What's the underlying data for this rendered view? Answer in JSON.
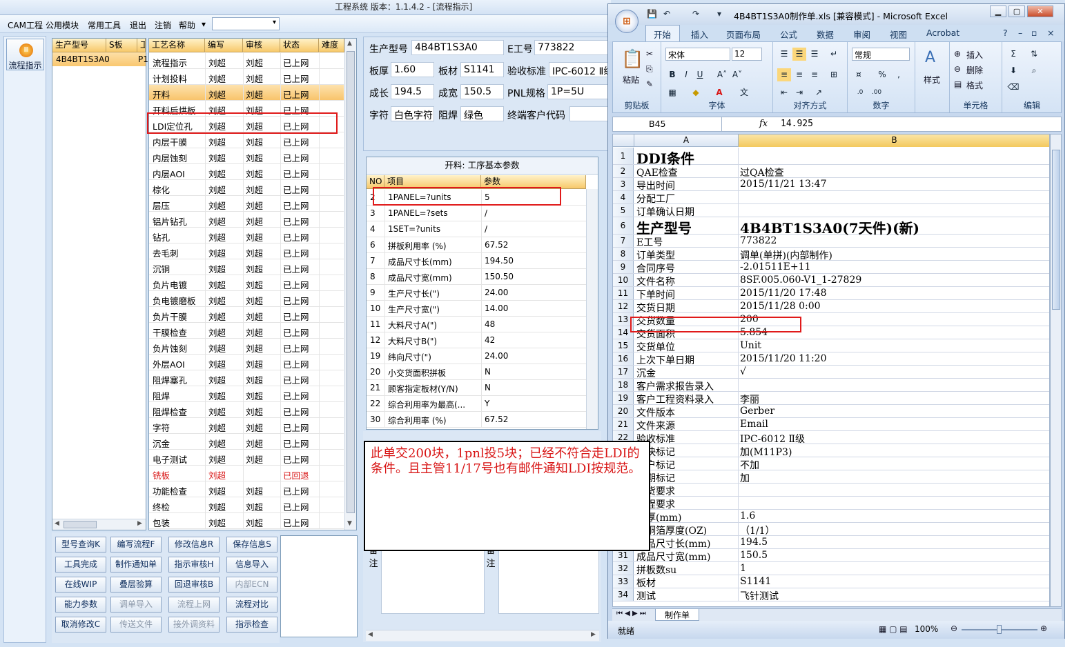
{
  "app": {
    "title": "工程系统   版本：1.1.4.2 - [流程指示]",
    "menu": [
      "CAM工程",
      "公用模块",
      "常用工具",
      "退出",
      "注销",
      "帮助"
    ],
    "menu_combo_arrow": "▾",
    "nav_button_label": "流程指示"
  },
  "model_list": {
    "headers": [
      "生产型号",
      "S板",
      "工"
    ],
    "row": [
      "4B4BT1S3A0",
      "P1"
    ]
  },
  "process_grid": {
    "headers": [
      "工艺名称",
      "编写",
      "审核",
      "状态",
      "难度"
    ],
    "rows": [
      [
        "流程指示",
        "刘超",
        "刘超",
        "已上网"
      ],
      [
        "计划投料",
        "刘超",
        "刘超",
        "已上网"
      ],
      [
        "开料",
        "刘超",
        "刘超",
        "已上网"
      ],
      [
        "开料后烘板",
        "刘超",
        "刘超",
        "已上网"
      ],
      [
        "LDI定位孔",
        "刘超",
        "刘超",
        "已上网"
      ],
      [
        "内层干膜",
        "刘超",
        "刘超",
        "已上网"
      ],
      [
        "内层蚀刻",
        "刘超",
        "刘超",
        "已上网"
      ],
      [
        "内层AOI",
        "刘超",
        "刘超",
        "已上网"
      ],
      [
        "棕化",
        "刘超",
        "刘超",
        "已上网"
      ],
      [
        "层压",
        "刘超",
        "刘超",
        "已上网"
      ],
      [
        "铝片钻孔",
        "刘超",
        "刘超",
        "已上网"
      ],
      [
        "钻孔",
        "刘超",
        "刘超",
        "已上网"
      ],
      [
        "去毛刺",
        "刘超",
        "刘超",
        "已上网"
      ],
      [
        "沉铜",
        "刘超",
        "刘超",
        "已上网"
      ],
      [
        "负片电镀",
        "刘超",
        "刘超",
        "已上网"
      ],
      [
        "负电镀磨板",
        "刘超",
        "刘超",
        "已上网"
      ],
      [
        "负片干膜",
        "刘超",
        "刘超",
        "已上网"
      ],
      [
        "干膜检查",
        "刘超",
        "刘超",
        "已上网"
      ],
      [
        "负片蚀刻",
        "刘超",
        "刘超",
        "已上网"
      ],
      [
        "外层AOI",
        "刘超",
        "刘超",
        "已上网"
      ],
      [
        "阻焊塞孔",
        "刘超",
        "刘超",
        "已上网"
      ],
      [
        "阻焊",
        "刘超",
        "刘超",
        "已上网"
      ],
      [
        "阻焊检查",
        "刘超",
        "刘超",
        "已上网"
      ],
      [
        "字符",
        "刘超",
        "刘超",
        "已上网"
      ],
      [
        "沉金",
        "刘超",
        "刘超",
        "已上网"
      ],
      [
        "电子测试",
        "刘超",
        "刘超",
        "已上网"
      ],
      [
        "铣板",
        "刘超",
        "",
        "已回退"
      ],
      [
        "功能检查",
        "刘超",
        "刘超",
        "已上网"
      ],
      [
        "终检",
        "刘超",
        "刘超",
        "已上网"
      ],
      [
        "包装",
        "刘超",
        "刘超",
        "已上网"
      ]
    ],
    "selected_row": 2,
    "returned_row": 26,
    "highlighted_row": 4
  },
  "info": {
    "model_label": "生产型号",
    "model_value": "4B4BT1S3A0",
    "eno_label": "E工号",
    "eno_value": "773822",
    "thick_label": "板厚",
    "thick_value": "1.60",
    "material_label": "板材",
    "material_value": "S1141",
    "standard_label": "验收标准",
    "standard_value": "IPC-6012 Ⅱ级",
    "len_label": "成长",
    "len_value": "194.5",
    "wid_label": "成宽",
    "wid_value": "150.5",
    "pnl_label": "PNL规格",
    "pnl_value": "1P=5U",
    "char_label": "字符",
    "char_value": "白色字符",
    "mask_label": "阻焊",
    "mask_value": "绿色",
    "customer_label": "终端客户代码",
    "customer_value": ""
  },
  "params": {
    "title": "开料: 工序基本参数",
    "headers": [
      "NO",
      "项目",
      "参数"
    ],
    "rows": [
      [
        "2",
        "1PANEL=?units",
        "5"
      ],
      [
        "3",
        "1PANEL=?sets",
        "/"
      ],
      [
        "4",
        "1SET=?units",
        "/"
      ],
      [
        "6",
        "拼板利用率 (%)",
        "67.52"
      ],
      [
        "7",
        "成品尺寸长(mm)",
        "194.50"
      ],
      [
        "8",
        "成品尺寸宽(mm)",
        "150.50"
      ],
      [
        "9",
        "生产尺寸长(\")",
        "24.00"
      ],
      [
        "10",
        "生产尺寸宽(\")",
        "14.00"
      ],
      [
        "11",
        "大料尺寸A(\")",
        "48"
      ],
      [
        "12",
        "大料尺寸B(\")",
        "42"
      ],
      [
        "19",
        "纬向尺寸(\")",
        "24.00"
      ],
      [
        "20",
        "小交货面积拼板",
        "N"
      ],
      [
        "21",
        "顾客指定板材(Y/N)",
        "N"
      ],
      [
        "22",
        "综合利用率为最高(...",
        "Y"
      ],
      [
        "30",
        "综合利用率 (%)",
        "67.52"
      ]
    ]
  },
  "buttons": [
    [
      "型号查询K",
      "编写流程F",
      "修改信息R",
      "保存信息S"
    ],
    [
      "工具完成",
      "制作通知单",
      "指示审核H",
      "信息导入"
    ],
    [
      "在线WIP",
      "叠层验算",
      "回退审核B",
      "内部ECN"
    ],
    [
      "能力参数",
      "调单导入",
      "流程上网",
      "流程对比"
    ],
    [
      "取消修改C",
      "传送文件",
      "接外调资料",
      "指示检查"
    ]
  ],
  "disabled_buttons": [
    "内部ECN",
    "调单导入",
    "流程上网",
    "传送文件",
    "接外调资料"
  ],
  "remark_label_left": "备注",
  "remark_label_right": "备注",
  "annotation": "此单交200块，1pnl投5块；已经不符合走LDI的条件。且主管11/17号也有邮件通知LDI按规范。",
  "excel": {
    "title": "4B4BT1S3A0制作单.xls  [兼容模式] - Microsoft Excel",
    "orb_icon": "office-logo",
    "qat_icons": [
      "save-icon",
      "undo-icon",
      "redo-icon"
    ],
    "tabs": [
      "开始",
      "插入",
      "页面布局",
      "公式",
      "数据",
      "审阅",
      "视图",
      "Acrobat"
    ],
    "ribbon": {
      "paste": "粘贴",
      "clipboard": "剪贴板",
      "font_name": "宋体",
      "font_size": "12",
      "font": "字体",
      "align": "对齐方式",
      "number_format": "常规",
      "number": "数字",
      "style": "样式",
      "insert": "插入",
      "delete": "删除",
      "format": "格式",
      "cells": "单元格",
      "edit": "编辑"
    },
    "name_box": "B45",
    "fx": "fx",
    "formula_value": "14.925",
    "col_a": "A",
    "col_b": "B",
    "rows": [
      {
        "n": "1",
        "a": "DDI条件",
        "b": "",
        "big": true
      },
      {
        "n": "2",
        "a": "QAE检查",
        "b": "过QA检查"
      },
      {
        "n": "3",
        "a": "导出时间",
        "b": "2015/11/21 13:47"
      },
      {
        "n": "4",
        "a": "分配工厂",
        "b": ""
      },
      {
        "n": "5",
        "a": "订单确认日期",
        "b": ""
      },
      {
        "n": "6",
        "a": "生产型号",
        "b": "4B4BT1S3A0(7天件)(新)",
        "big": true
      },
      {
        "n": "7",
        "a": "E工号",
        "b": "773822"
      },
      {
        "n": "8",
        "a": "订单类型",
        "b": "调单(单拼)(内部制作)"
      },
      {
        "n": "9",
        "a": "合同序号",
        "b": "-2.01511E+11"
      },
      {
        "n": "10",
        "a": "文件名称",
        "b": "8SF.005.060-V1_1-27829"
      },
      {
        "n": "11",
        "a": "下单时间",
        "b": "2015/11/20 17:48"
      },
      {
        "n": "12",
        "a": "交货日期",
        "b": "2015/11/28 0:00"
      },
      {
        "n": "13",
        "a": "交货数量",
        "b": "200"
      },
      {
        "n": "14",
        "a": "交货面积",
        "b": "5.854"
      },
      {
        "n": "15",
        "a": "交货单位",
        "b": "Unit"
      },
      {
        "n": "16",
        "a": "上次下单日期",
        "b": "2015/11/20 11:20"
      },
      {
        "n": "17",
        "a": "沉金",
        "b": "√"
      },
      {
        "n": "18",
        "a": "客户需求报告录入",
        "b": ""
      },
      {
        "n": "19",
        "a": "客户工程资料录入",
        "b": "李丽"
      },
      {
        "n": "20",
        "a": "文件版本",
        "b": "Gerber"
      },
      {
        "n": "21",
        "a": "文件来源",
        "b": "Email"
      },
      {
        "n": "22",
        "a": "验收标准",
        "b": "IPC-6012 Ⅱ级"
      },
      {
        "n": "23",
        "a": "加快标记",
        "b": "加(M11P3)"
      },
      {
        "n": "24",
        "a": "客户标记",
        "b": "不加"
      },
      {
        "n": "25",
        "a": "日期标记",
        "b": "加"
      },
      {
        "n": "26",
        "a": "交货要求",
        "b": ""
      },
      {
        "n": "27",
        "a": "工程要求",
        "b": ""
      },
      {
        "n": "28",
        "a": "板厚(mm)",
        "b": "1.6"
      },
      {
        "n": "29",
        "a": "外铜箔厚度(OZ)",
        "b": "（1/1）"
      },
      {
        "n": "30",
        "a": "成品尺寸长(mm)",
        "b": "194.5"
      },
      {
        "n": "31",
        "a": "成品尺寸宽(mm)",
        "b": "150.5"
      },
      {
        "n": "32",
        "a": "拼板数su",
        "b": "1"
      },
      {
        "n": "33",
        "a": "板材",
        "b": "S1141"
      },
      {
        "n": "34",
        "a": "测试",
        "b": "飞针测试"
      }
    ],
    "sheet_tab": "制作单",
    "status_ready": "就绪",
    "zoom": "100%"
  }
}
